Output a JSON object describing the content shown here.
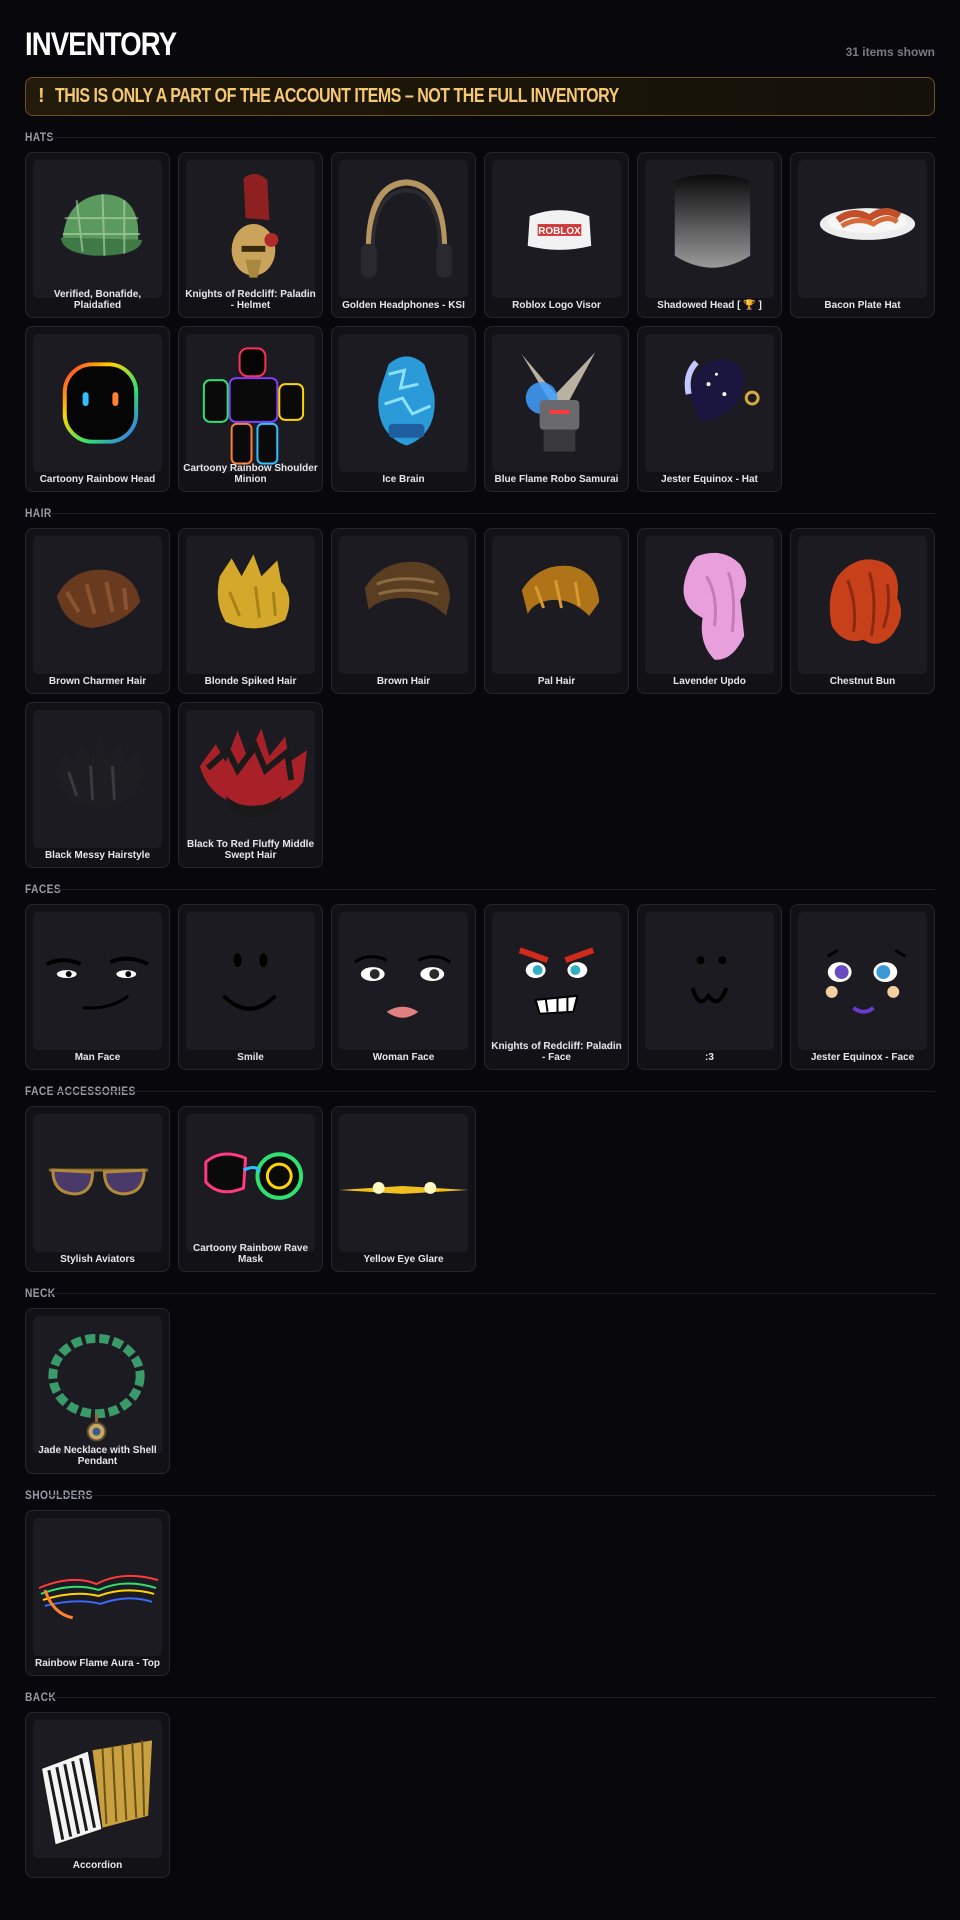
{
  "header": {
    "title": "INVENTORY",
    "count": "31 items shown"
  },
  "banner": {
    "icon": "!",
    "text": "THIS IS ONLY A PART OF THE ACCOUNT ITEMS – NOT THE FULL INVENTORY"
  },
  "sections": {
    "hats": {
      "title": "HATS",
      "items": [
        {
          "name": "Verified, Bonafide, Plaidafied",
          "icon": "plaid-cap"
        },
        {
          "name": "Knights of Redcliff: Paladin - Helmet",
          "icon": "paladin-helmet"
        },
        {
          "name": "Golden Headphones - KSI",
          "icon": "headphones"
        },
        {
          "name": "Roblox Logo Visor",
          "icon": "visor"
        },
        {
          "name": "Shadowed Head [ 🏆 ]",
          "icon": "shadow-head"
        },
        {
          "name": "Bacon Plate Hat",
          "icon": "bacon-plate"
        },
        {
          "name": "Cartoony Rainbow Head",
          "icon": "rainbow-head"
        },
        {
          "name": "Cartoony Rainbow Shoulder Minion",
          "icon": "rainbow-minion"
        },
        {
          "name": "Ice Brain",
          "icon": "ice-brain"
        },
        {
          "name": "Blue Flame Robo Samurai",
          "icon": "robo-samurai"
        },
        {
          "name": "Jester Equinox - Hat",
          "icon": "jester-hat"
        }
      ]
    },
    "hair": {
      "title": "HAIR",
      "items": [
        {
          "name": "Brown Charmer Hair",
          "icon": "hair-brown-charmer"
        },
        {
          "name": "Blonde Spiked Hair",
          "icon": "hair-blonde"
        },
        {
          "name": "Brown Hair",
          "icon": "hair-brown"
        },
        {
          "name": "Pal Hair",
          "icon": "hair-pal"
        },
        {
          "name": "Lavender Updo",
          "icon": "hair-lavender"
        },
        {
          "name": "Chestnut Bun",
          "icon": "hair-chestnut"
        },
        {
          "name": "Black Messy Hairstyle",
          "icon": "hair-black"
        },
        {
          "name": "Black To Red Fluffy Middle Swept Hair",
          "icon": "hair-black-red"
        }
      ]
    },
    "faces": {
      "title": "FACES",
      "items": [
        {
          "name": "Man Face",
          "icon": "face-man"
        },
        {
          "name": "Smile",
          "icon": "face-smile"
        },
        {
          "name": "Woman Face",
          "icon": "face-woman"
        },
        {
          "name": "Knights of Redcliff: Paladin - Face",
          "icon": "face-paladin"
        },
        {
          "name": ":3",
          "icon": "face-cat"
        },
        {
          "name": "Jester Equinox - Face",
          "icon": "face-jester"
        }
      ]
    },
    "face_accessories": {
      "title": "FACE ACCESSORIES",
      "items": [
        {
          "name": "Stylish Aviators",
          "icon": "aviators"
        },
        {
          "name": "Cartoony Rainbow Rave Mask",
          "icon": "rave-mask"
        },
        {
          "name": "Yellow Eye Glare",
          "icon": "eye-glare"
        }
      ]
    },
    "neck": {
      "title": "NECK",
      "items": [
        {
          "name": "Jade Necklace with Shell Pendant",
          "icon": "jade-necklace"
        }
      ]
    },
    "shoulders": {
      "title": "SHOULDERS",
      "items": [
        {
          "name": "Rainbow Flame Aura - Top",
          "icon": "flame-aura"
        }
      ]
    },
    "back": {
      "title": "BACK",
      "items": [
        {
          "name": "Accordion",
          "icon": "accordion"
        }
      ]
    }
  },
  "colors": {
    "background": "#08080c",
    "card": "#111116",
    "banner_text": "#f5c874",
    "banner_border": "#6a5320"
  }
}
